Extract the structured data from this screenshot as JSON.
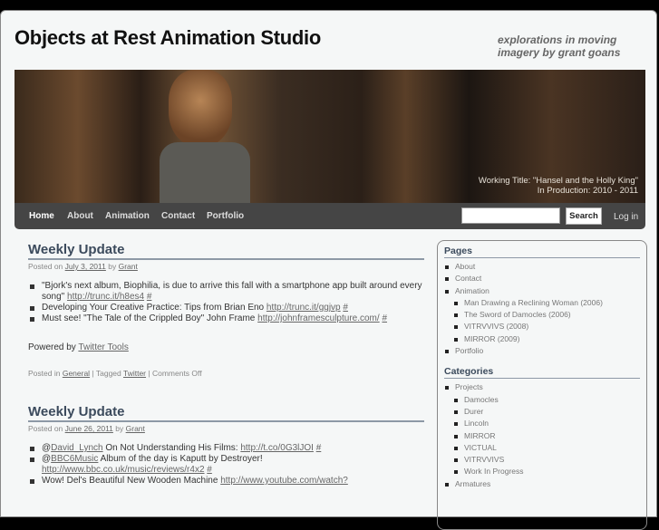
{
  "site": {
    "title": "Objects at Rest Animation Studio",
    "tagline": "explorations in moving imagery by grant goans"
  },
  "banner": {
    "line1": "Working Title: \"Hansel and the Holly King\"",
    "line2": "In Production: 2010 - 2011"
  },
  "nav": {
    "items": [
      "Home",
      "About",
      "Animation",
      "Contact",
      "Portfolio"
    ],
    "search_label": "Search",
    "search_value": "",
    "login": "Log in"
  },
  "posts": [
    {
      "title": "Weekly Update",
      "posted_on": "Posted on",
      "date": "July 3, 2011",
      "by": "by",
      "author": "Grant",
      "items": [
        {
          "text": "\"Bjork's next album, Biophilia, is due to arrive this fall with a smartphone app built around every song\"",
          "link": "http://trunc.it/h8es4",
          "hash": "#"
        },
        {
          "text": "Developing Your Creative Practice: Tips from Brian Eno",
          "link": "http://trunc.it/ggjvp",
          "hash": "#"
        },
        {
          "text": "Must see! \"The Tale of the Crippled Boy\" John Frame",
          "link": "http://johnframesculpture.com/",
          "hash": "#"
        }
      ],
      "powered": "Powered by",
      "powered_link": "Twitter Tools",
      "posted_in": "Posted in",
      "category": "General",
      "tagged": "| Tagged",
      "tag": "Twitter",
      "comments": "| Comments Off"
    },
    {
      "title": "Weekly Update",
      "posted_on": "Posted on",
      "date": "June 26, 2011",
      "by": "by",
      "author": "Grant",
      "items": [
        {
          "at": "@",
          "user": "David_Lynch",
          "text": "On Not Understanding His Films:",
          "link": "http://t.co/0G3lJOI",
          "hash": "#"
        },
        {
          "at": "@",
          "user": "BBC6Music",
          "text": "Album of the day is Kaputt by Destroyer!",
          "link": "http://www.bbc.co.uk/music/reviews/r4x2",
          "hash": "#"
        },
        {
          "text": "Wow! Del's Beautiful New Wooden Machine",
          "link": "http://www.youtube.com/watch?"
        }
      ]
    }
  ],
  "sidebar": {
    "pages_title": "Pages",
    "pages": [
      {
        "label": "About"
      },
      {
        "label": "Contact"
      },
      {
        "label": "Animation"
      },
      {
        "label": "Man Drawing a Reclining Woman (2006)",
        "sub": true
      },
      {
        "label": "The Sword of Damocles (2006)",
        "sub": true
      },
      {
        "label": "VITRVVIVS (2008)",
        "sub": true
      },
      {
        "label": "MIRROR (2009)",
        "sub": true
      },
      {
        "label": "Portfolio"
      }
    ],
    "categories_title": "Categories",
    "categories": [
      {
        "label": "Projects"
      },
      {
        "label": "Damocles",
        "sub": true
      },
      {
        "label": "Durer",
        "sub": true
      },
      {
        "label": "Lincoln",
        "sub": true
      },
      {
        "label": "MIRROR",
        "sub": true
      },
      {
        "label": "VICTUAL",
        "sub": true
      },
      {
        "label": "VITRVVIVS",
        "sub": true
      },
      {
        "label": "Work In Progress",
        "sub": true
      },
      {
        "label": "Armatures"
      }
    ]
  }
}
